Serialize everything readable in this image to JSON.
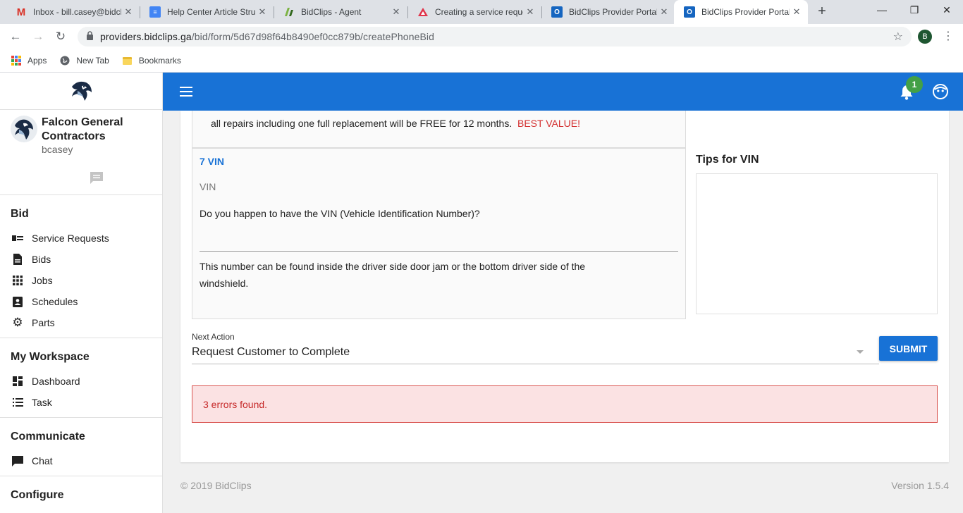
{
  "browser": {
    "tabs": [
      {
        "title": "Inbox - bill.casey@bidcl",
        "icon": "gmail-icon",
        "color": "#d93025"
      },
      {
        "title": "Help Center Article Stru",
        "icon": "docs-icon",
        "color": "#4285f4"
      },
      {
        "title": "BidClips - Agent",
        "icon": "bidclips-agent-icon",
        "color": "#3f7d20"
      },
      {
        "title": "Creating a service reque",
        "icon": "triangle-icon",
        "color": "#e0344a"
      },
      {
        "title": "BidClips Provider Portal",
        "icon": "outlook-icon",
        "color": "#1565c0"
      },
      {
        "title": "BidClips Provider Portal",
        "icon": "outlook-icon",
        "color": "#1565c0"
      }
    ],
    "url_host": "providers.bidclips.ga",
    "url_path": "/bid/form/5d67d98f64b8490ef0cc879b/createPhoneBid",
    "profile_initial": "B",
    "bookmarks": [
      "Apps",
      "New Tab",
      "Bookmarks"
    ]
  },
  "sidebar": {
    "company_name": "Falcon General Contractors",
    "username": "bcasey",
    "sections": [
      {
        "title": "Bid",
        "items": [
          {
            "label": "Service Requests",
            "icon": "service-requests-icon"
          },
          {
            "label": "Bids",
            "icon": "document-icon"
          },
          {
            "label": "Jobs",
            "icon": "grid-icon"
          },
          {
            "label": "Schedules",
            "icon": "contact-card-icon"
          },
          {
            "label": "Parts",
            "icon": "gear-icon"
          }
        ]
      },
      {
        "title": "My Workspace",
        "items": [
          {
            "label": "Dashboard",
            "icon": "dashboard-icon"
          },
          {
            "label": "Task",
            "icon": "list-icon"
          }
        ]
      },
      {
        "title": "Communicate",
        "items": [
          {
            "label": "Chat",
            "icon": "chat-icon"
          }
        ]
      },
      {
        "title": "Configure",
        "items": []
      }
    ]
  },
  "header": {
    "notification_count": "1",
    "accent": "#1872d6"
  },
  "form": {
    "prev_line_text": "all repairs including one full replacement will be FREE for 12 months.",
    "prev_line_highlight": "BEST VALUE!",
    "question_number": "7 VIN",
    "question_label": "VIN",
    "question_text": "Do you happen to have the VIN (Vehicle Identification Number)?",
    "answer_value": "",
    "help_text": "This number can be found inside the driver side door jam or the bottom driver side of the windshield.",
    "tips_title": "Tips for VIN",
    "next_action_label": "Next Action",
    "next_action_value": "Request Customer to Complete",
    "submit_label": "SUBMIT",
    "error_text": "3 errors found."
  },
  "footer": {
    "copyright": "© 2019 BidClips",
    "version": "Version 1.5.4"
  }
}
